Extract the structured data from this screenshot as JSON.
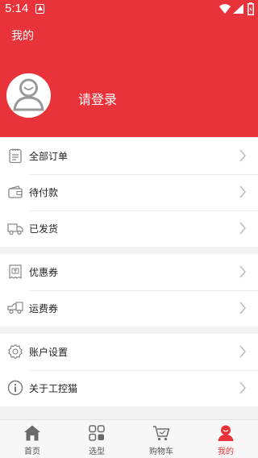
{
  "status_bar": {
    "time": "5:14"
  },
  "header": {
    "title": "我的",
    "login_label": "请登录"
  },
  "menu": {
    "group1": [
      {
        "label": "全部订单",
        "icon": "clipboard-icon"
      },
      {
        "label": "待付款",
        "icon": "wallet-icon"
      },
      {
        "label": "已发货",
        "icon": "truck-icon"
      }
    ],
    "group2": [
      {
        "label": "优惠券",
        "icon": "coupon-icon"
      },
      {
        "label": "运费券",
        "icon": "shipping-truck-icon"
      }
    ],
    "group3": [
      {
        "label": "账户设置",
        "icon": "settings-gear-icon"
      },
      {
        "label": "关于工控猫",
        "icon": "info-icon"
      }
    ]
  },
  "tabs": [
    {
      "label": "首页",
      "icon": "home-icon",
      "active": false
    },
    {
      "label": "选型",
      "icon": "grid-icon",
      "active": false
    },
    {
      "label": "购物车",
      "icon": "cart-icon",
      "active": false
    },
    {
      "label": "我的",
      "icon": "profile-icon",
      "active": true
    }
  ],
  "colors": {
    "accent": "#e8333b",
    "background": "#f2f2f2",
    "icon_gray": "#888888"
  }
}
